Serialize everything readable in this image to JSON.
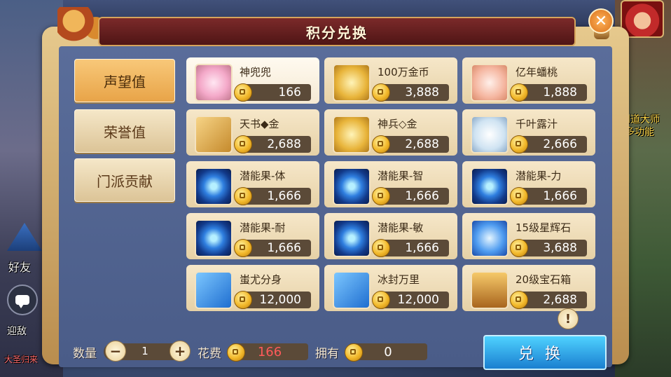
{
  "window": {
    "title": "积分兑换",
    "close_symbol": "✕"
  },
  "side": {
    "left_label": "好友",
    "left_small_1": "迎敌",
    "left_small_2": "大圣归来",
    "right_label_1": "门道大师",
    "right_label_2": "多功能"
  },
  "tabs": [
    {
      "label": "声望值",
      "active": true
    },
    {
      "label": "荣誉值",
      "active": false
    },
    {
      "label": "门派贡献",
      "active": false
    }
  ],
  "items": [
    {
      "name": "神兜兜",
      "price": "166",
      "icon": "pig-charm-icon",
      "selected": true
    },
    {
      "name": "100万金币",
      "price": "3,888",
      "icon": "gold-coin-icon"
    },
    {
      "name": "亿年蟠桃",
      "price": "1,888",
      "icon": "peach-icon"
    },
    {
      "name": "天书◆金",
      "price": "2,688",
      "icon": "scroll-icon"
    },
    {
      "name": "神兵◇金",
      "price": "2,688",
      "icon": "gold-coin-icon"
    },
    {
      "name": "千叶露汁",
      "price": "2,666",
      "icon": "vase-icon"
    },
    {
      "name": "潜能果-体",
      "price": "1,666",
      "icon": "blue-orb-icon"
    },
    {
      "name": "潜能果-智",
      "price": "1,666",
      "icon": "blue-orb-icon"
    },
    {
      "name": "潜能果-力",
      "price": "1,666",
      "icon": "blue-orb-icon"
    },
    {
      "name": "潜能果-耐",
      "price": "1,666",
      "icon": "blue-orb-icon"
    },
    {
      "name": "潜能果-敏",
      "price": "1,666",
      "icon": "blue-orb-icon"
    },
    {
      "name": "15级星辉石",
      "price": "3,688",
      "icon": "gem-icon"
    },
    {
      "name": "蚩尤分身",
      "price": "12,000",
      "icon": "book-icon"
    },
    {
      "name": "冰封万里",
      "price": "12,000",
      "icon": "book-icon"
    },
    {
      "name": "20级宝石箱",
      "price": "2,688",
      "icon": "chest-icon"
    }
  ],
  "bottom": {
    "quantity_label": "数量",
    "quantity_value": "1",
    "minus": "−",
    "plus": "+",
    "cost_label": "花费",
    "cost_value": "166",
    "own_label": "拥有",
    "own_value": "0",
    "exchange_label": "兑换",
    "info_symbol": "!"
  },
  "colors": {
    "cost_red": "#ff5a5a",
    "own_white": "#ffffff"
  }
}
